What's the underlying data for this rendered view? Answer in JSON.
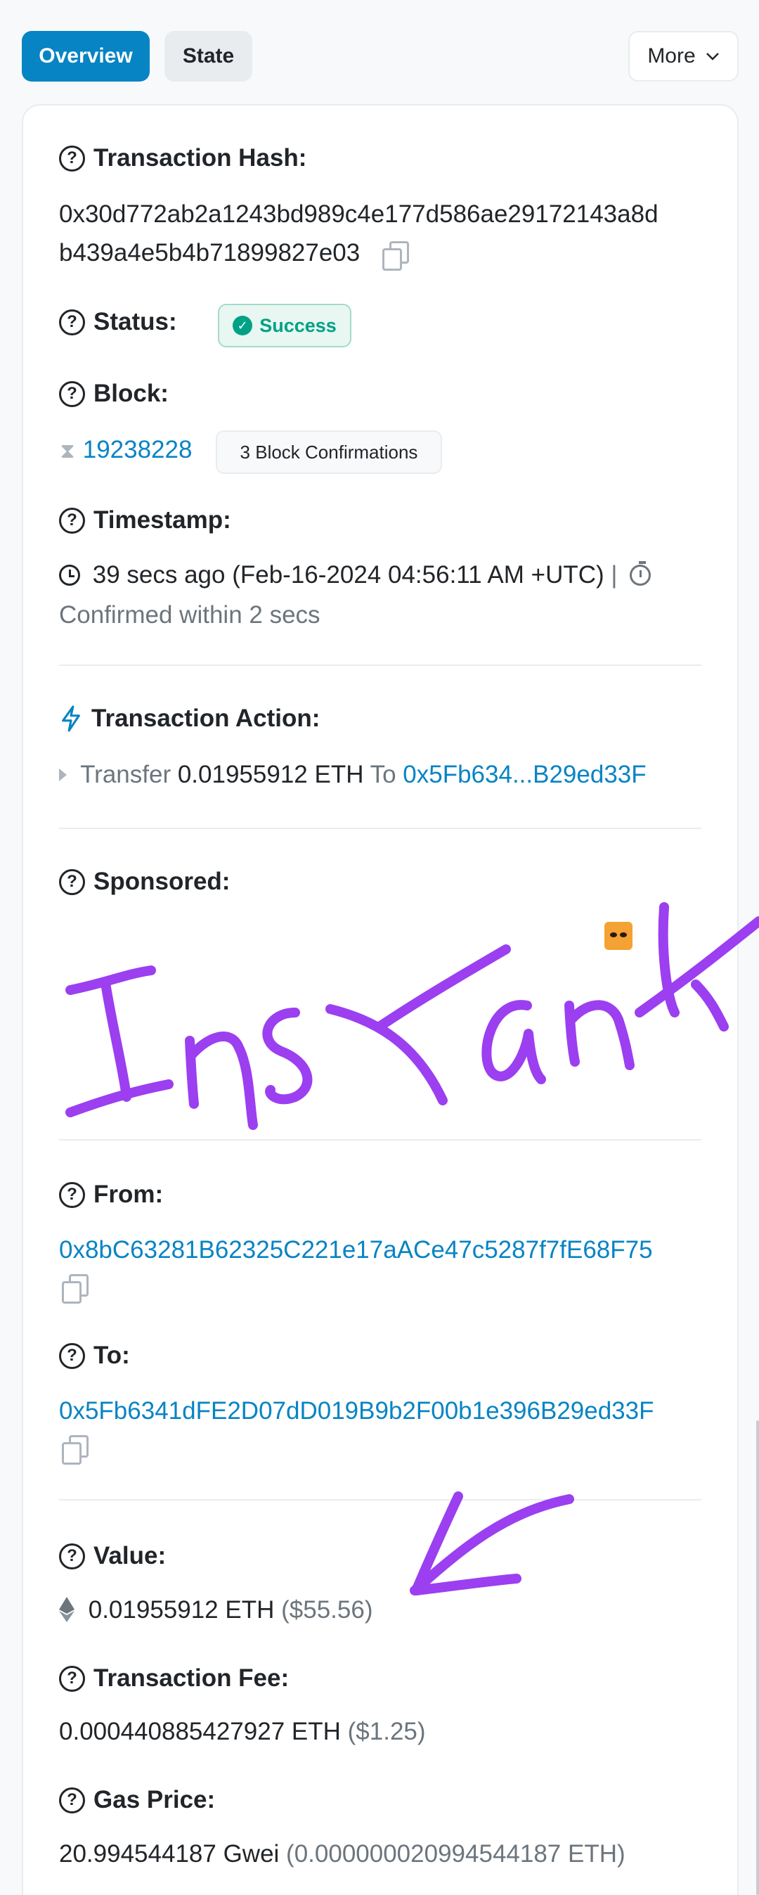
{
  "tabs": {
    "overview": "Overview",
    "state": "State",
    "more": "More"
  },
  "tx_hash": {
    "label": "Transaction Hash:",
    "line1": "0x30d772ab2a1243bd989c4e177d586ae29172143a8d",
    "line2": "b439a4e5b4b71899827e03"
  },
  "status": {
    "label": "Status:",
    "value": "Success"
  },
  "block": {
    "label": "Block:",
    "number": "19238228",
    "confirmations": "3 Block Confirmations"
  },
  "timestamp": {
    "label": "Timestamp:",
    "value": "39 secs ago (Feb-16-2024 04:56:11 AM +UTC)",
    "separator": "|",
    "confirmed": "Confirmed within 2 secs"
  },
  "action": {
    "label": "Transaction Action:",
    "verb": "Transfer",
    "amount": "0.01955912 ETH",
    "to_word": "To",
    "to_addr": "0x5Fb634...B29ed33F"
  },
  "sponsored": {
    "label": "Sponsored:"
  },
  "from": {
    "label": "From:",
    "address": "0x8bC63281B62325C221e17aACe47c5287f7fE68F75"
  },
  "to": {
    "label": "To:",
    "address": "0x5Fb6341dFE2D07dD019B9b2F00b1e396B29ed33F"
  },
  "value": {
    "label": "Value:",
    "amount": "0.01955912 ETH",
    "usd": "($55.56)"
  },
  "fee": {
    "label": "Transaction Fee:",
    "amount": "0.000440885427927 ETH",
    "usd": "($1.25)"
  },
  "gas": {
    "label": "Gas Price:",
    "amount": "20.994544187 Gwei",
    "eth": "(0.000000020994544187 ETH)"
  },
  "colors": {
    "accent": "#0784c3",
    "success": "#00a186",
    "annotation": "#9b3ff0"
  }
}
